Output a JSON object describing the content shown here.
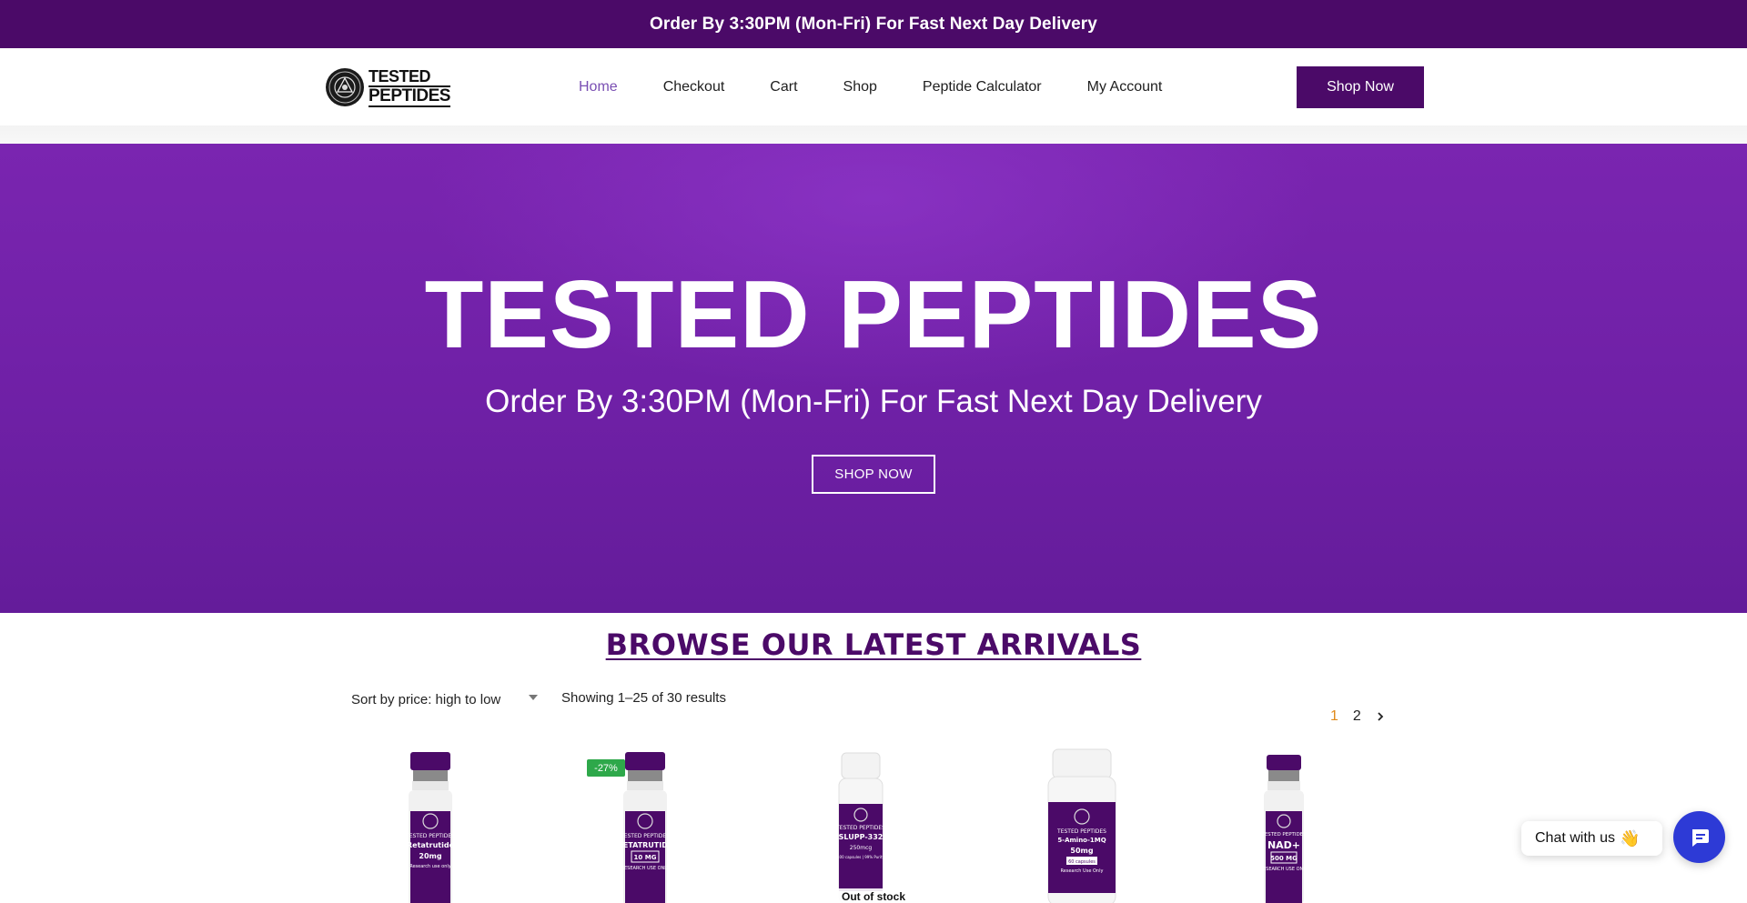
{
  "announcement": "Order By 3:30PM (Mon-Fri) For Fast Next Day Delivery",
  "logo": {
    "line1": "TESTED",
    "line2": "PEPTIDES"
  },
  "nav": {
    "items": [
      {
        "label": "Home",
        "active": true
      },
      {
        "label": "Checkout"
      },
      {
        "label": "Cart"
      },
      {
        "label": "Shop"
      },
      {
        "label": "Peptide Calculator"
      },
      {
        "label": "My Account"
      }
    ],
    "cta": "Shop Now"
  },
  "hero": {
    "title": "TESTED PEPTIDES",
    "subtitle": "Order By 3:30PM (Mon-Fri) For Fast Next Day Delivery",
    "button": "SHOP NOW"
  },
  "catalog": {
    "heading": "BROWSE OUR LATEST ARRIVALS",
    "sort_label": "Sort by price: high to low",
    "results_text": "Showing 1–25 of 30 results",
    "pages": [
      "1",
      "2"
    ],
    "current_page": "1"
  },
  "products": [
    {
      "brand": "TESTED PEPTIDES",
      "name": "Retatrutide",
      "dose": "20mg",
      "note": "Research use only",
      "type": "vial"
    },
    {
      "brand": "TESTED PEPTIDES",
      "name": "RETATRUTIDE",
      "dose": "10 MG",
      "note": "RESEARCH USE ONLY",
      "type": "vial",
      "badge": "-27%"
    },
    {
      "brand": "TESTED PEPTIDES",
      "name": "SLUPP-332",
      "dose": "250mcg",
      "note": "100 capsules | 99% Purity",
      "type": "bottle",
      "status": "Out of stock"
    },
    {
      "brand": "TESTED PEPTIDES",
      "name": "5-Amino-1MQ",
      "dose": "50mg",
      "note": "Research Use Only",
      "extra": "60 capsules",
      "type": "bottle"
    },
    {
      "brand": "TESTED PEPTIDES",
      "name": "NAD+",
      "dose": "500 MG",
      "note": "RESEARCH USE ONLY",
      "type": "vial"
    }
  ],
  "chat": {
    "label": "Chat with us",
    "emoji": "👋"
  },
  "colors": {
    "brand": "#4b0a68",
    "hero": "#7323a9",
    "badge": "#2ea84a",
    "chat": "#2d3ad6",
    "page_current": "#e08a1a"
  }
}
